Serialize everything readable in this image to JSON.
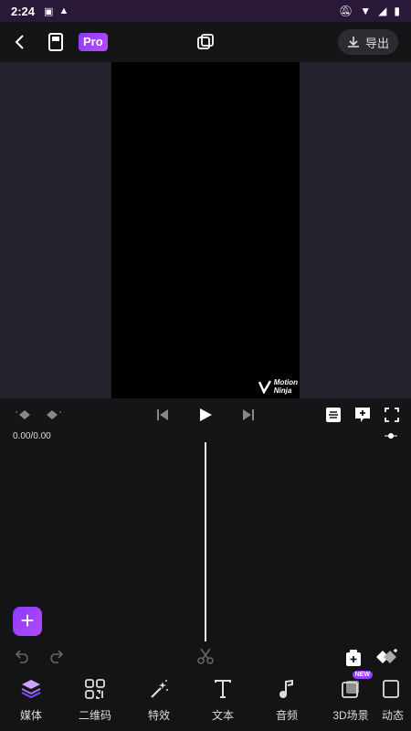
{
  "status": {
    "time": "2:24"
  },
  "topbar": {
    "pro_label": "Pro",
    "export_label": "导出"
  },
  "watermark": {
    "line1": "Motion",
    "line2": "Ninja"
  },
  "timeline": {
    "timecode": "0.00/0.00"
  },
  "tabs": [
    {
      "label": "媒体",
      "icon": "layers-stack-icon"
    },
    {
      "label": "二维码",
      "icon": "qr-code-icon"
    },
    {
      "label": "特效",
      "icon": "magic-wand-icon"
    },
    {
      "label": "文本",
      "icon": "text-icon"
    },
    {
      "label": "音频",
      "icon": "music-note-icon"
    },
    {
      "label": "3D场景",
      "icon": "3d-scene-icon",
      "badge": "NEW"
    },
    {
      "label": "动态",
      "icon": "motion-icon"
    }
  ],
  "colors": {
    "accent": "#9b3cff",
    "status_bar": "#2a1838",
    "background": "#141416",
    "preview_bg": "#22222d"
  }
}
